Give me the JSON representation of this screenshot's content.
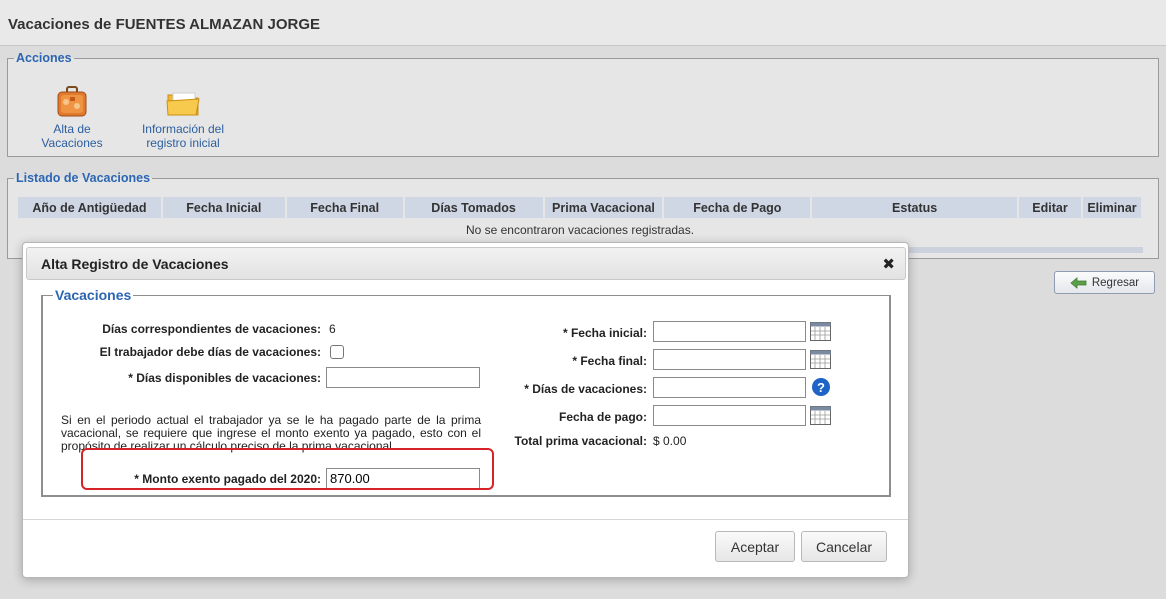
{
  "page": {
    "title": "Vacaciones de FUENTES ALMAZAN JORGE"
  },
  "acciones": {
    "legend": "Acciones",
    "items": [
      {
        "line1": "Alta de",
        "line2": "Vacaciones",
        "icon": "suitcase-icon"
      },
      {
        "line1": "Información del",
        "line2": "registro inicial",
        "icon": "folder-icon"
      }
    ]
  },
  "listado": {
    "legend": "Listado de Vacaciones",
    "columns": [
      "Año de Antigüedad",
      "Fecha Inicial",
      "Fecha Final",
      "Días Tomados",
      "Prima Vacacional",
      "Fecha de Pago",
      "Estatus",
      "Editar",
      "Eliminar"
    ],
    "empty_message": "No se encontraron vacaciones registradas."
  },
  "regresar": {
    "label": "Regresar",
    "icon": "back-arrow-icon"
  },
  "dialog": {
    "title": "Alta Registro de Vacaciones",
    "close": "✖",
    "legend": "Vacaciones",
    "left": {
      "dias_corr_label": "Días correspondientes de vacaciones:",
      "dias_corr_value": "6",
      "debe_label": "El trabajador debe días de vacaciones:",
      "debe_checked": false,
      "disp_label": "* Días disponibles de vacaciones:",
      "disp_value": "",
      "paragraph": "Si en el periodo actual el trabajador ya se le ha pagado parte de la prima vacacional, se requiere que ingrese el monto exento ya pagado, esto con el propósito de realizar un cálculo preciso de la prima vacacional.",
      "monto_label": "* Monto exento pagado del 2020:",
      "monto_value": "870.00"
    },
    "right": {
      "fecha_inicial_label": "* Fecha inicial:",
      "fecha_inicial_value": "",
      "fecha_final_label": "* Fecha final:",
      "fecha_final_value": "",
      "dias_vac_label": "* Días de vacaciones:",
      "dias_vac_value": "",
      "fecha_pago_label": "Fecha de pago:",
      "fecha_pago_value": "",
      "total_label": "Total prima vacacional:",
      "total_value": "$ 0.00"
    },
    "buttons": {
      "aceptar": "Aceptar",
      "cancelar": "Cancelar"
    }
  },
  "colors": {
    "accent_blue": "#2b66b3",
    "highlight_red": "#d6232a",
    "table_header": "#cfd6e4"
  }
}
